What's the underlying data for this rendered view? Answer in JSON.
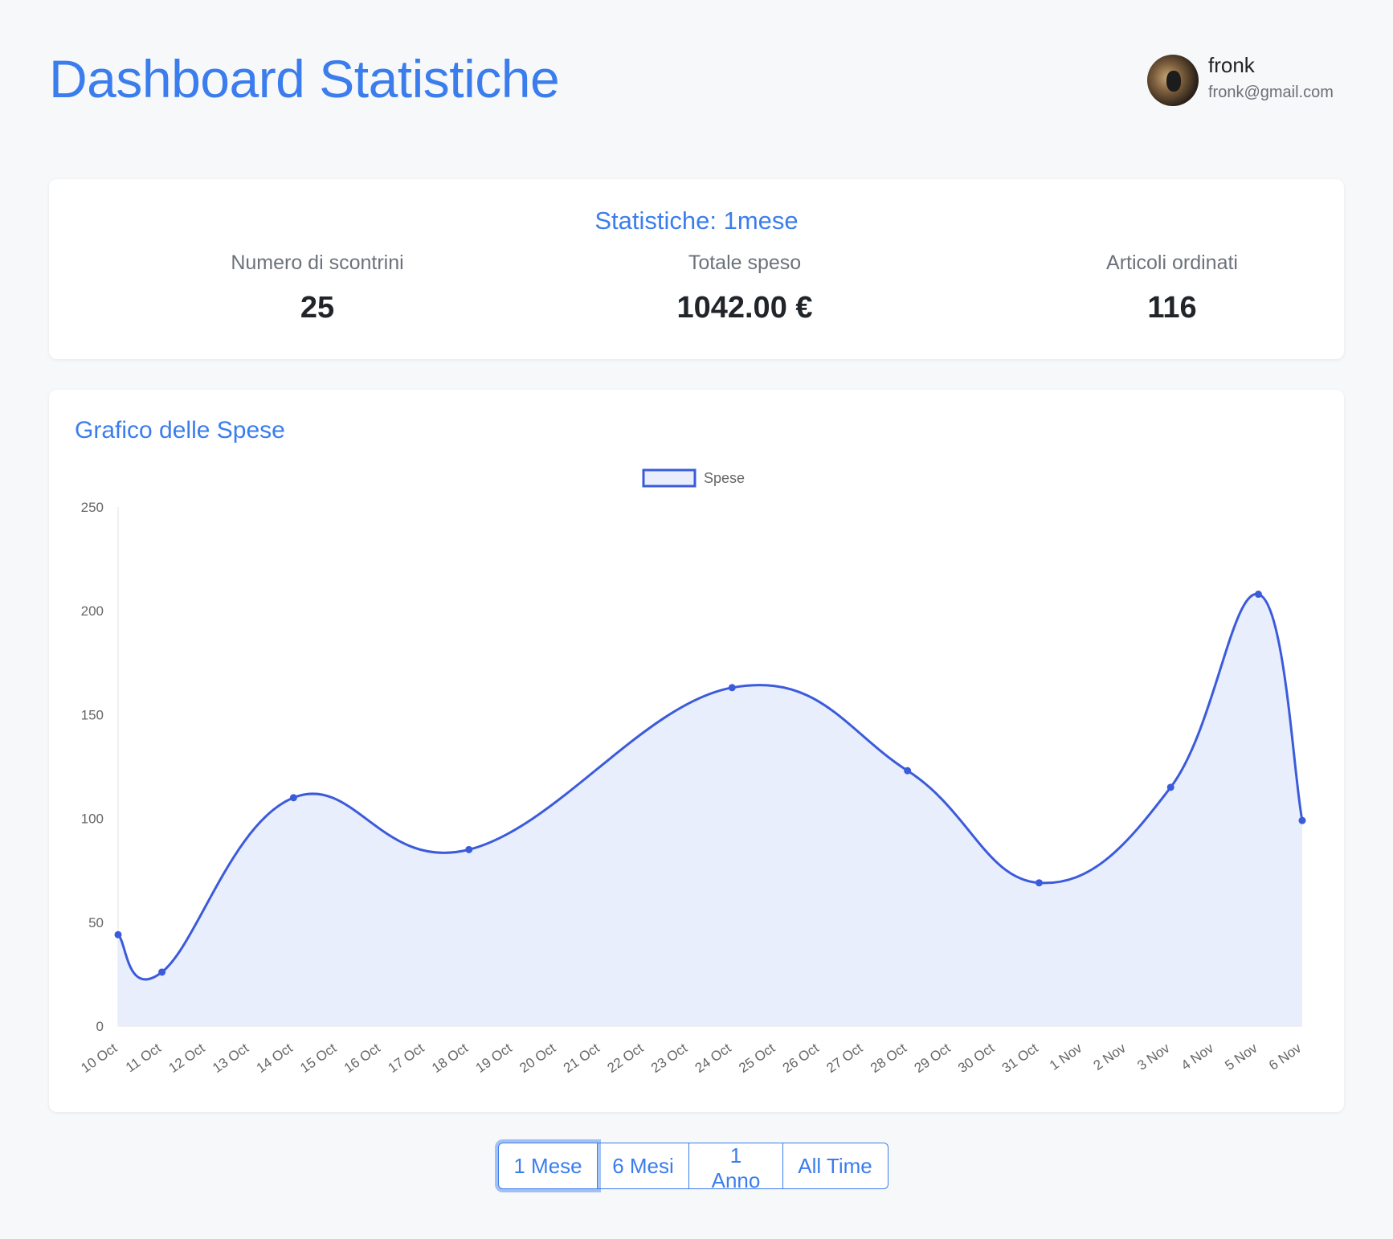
{
  "header": {
    "title": "Dashboard Statistiche",
    "user": {
      "name": "fronk",
      "email": "fronk@gmail.com"
    }
  },
  "stats": {
    "title": "Statistiche: 1mese",
    "items": [
      {
        "label": "Numero di scontrini",
        "value": "25"
      },
      {
        "label": "Totale speso",
        "value": "1042.00 €"
      },
      {
        "label": "Articoli ordinati",
        "value": "116"
      }
    ]
  },
  "chart_card": {
    "title": "Grafico delle Spese"
  },
  "chart_data": {
    "type": "area",
    "x": [
      "10 Oct",
      "11 Oct",
      "12 Oct",
      "13 Oct",
      "14 Oct",
      "15 Oct",
      "16 Oct",
      "17 Oct",
      "18 Oct",
      "19 Oct",
      "20 Oct",
      "21 Oct",
      "22 Oct",
      "23 Oct",
      "24 Oct",
      "25 Oct",
      "26 Oct",
      "27 Oct",
      "28 Oct",
      "29 Oct",
      "30 Oct",
      "31 Oct",
      "1 Nov",
      "2 Nov",
      "3 Nov",
      "4 Nov",
      "5 Nov",
      "6 Nov"
    ],
    "series": [
      {
        "name": "Spese",
        "points": [
          {
            "x": "10 Oct",
            "y": 44
          },
          {
            "x": "11 Oct",
            "y": 26
          },
          {
            "x": "14 Oct",
            "y": 110
          },
          {
            "x": "18 Oct",
            "y": 85
          },
          {
            "x": "24 Oct",
            "y": 163
          },
          {
            "x": "28 Oct",
            "y": 123
          },
          {
            "x": "31 Oct",
            "y": 69
          },
          {
            "x": "3 Nov",
            "y": 115
          },
          {
            "x": "5 Nov",
            "y": 208
          },
          {
            "x": "6 Nov",
            "y": 99
          }
        ]
      }
    ],
    "yticks": [
      "0",
      "50",
      "100",
      "150",
      "200",
      "250"
    ],
    "ylim": [
      0,
      250
    ],
    "legend": "top-center",
    "grid": false,
    "colors": {
      "line": "#3b5bdb",
      "fill": "#e8eefb"
    }
  },
  "ranges": {
    "buttons": [
      {
        "label": "1 Mese",
        "active": true
      },
      {
        "label": "6 Mesi",
        "active": false
      },
      {
        "label": "1 Anno",
        "active": false
      },
      {
        "label": "All Time",
        "active": false
      }
    ]
  }
}
